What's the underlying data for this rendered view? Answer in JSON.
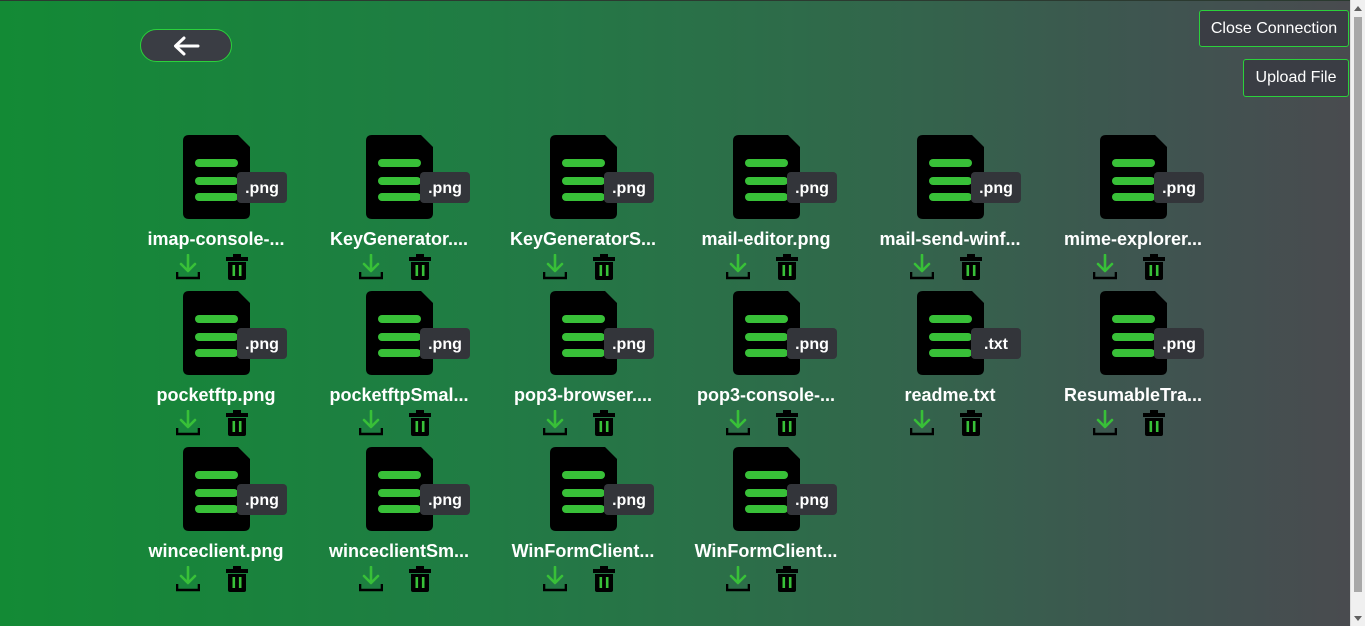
{
  "header": {
    "back_icon": "arrow-left-icon",
    "close_connection_label": "Close Connection",
    "upload_file_label": "Upload File"
  },
  "colors": {
    "accent": "#2bd13b",
    "button_bg": "#3a3d44",
    "icon_body": "#000000",
    "icon_lines": "#38c038",
    "badge_bg": "#33353a"
  },
  "files": [
    {
      "name": "imap-console-...",
      "ext": ".png"
    },
    {
      "name": "KeyGenerator....",
      "ext": ".png"
    },
    {
      "name": "KeyGeneratorS...",
      "ext": ".png"
    },
    {
      "name": "mail-editor.png",
      "ext": ".png"
    },
    {
      "name": "mail-send-winf...",
      "ext": ".png"
    },
    {
      "name": "mime-explorer...",
      "ext": ".png"
    },
    {
      "name": "pocketftp.png",
      "ext": ".png"
    },
    {
      "name": "pocketftpSmal...",
      "ext": ".png"
    },
    {
      "name": "pop3-browser....",
      "ext": ".png"
    },
    {
      "name": "pop3-console-...",
      "ext": ".png"
    },
    {
      "name": "readme.txt",
      "ext": ".txt"
    },
    {
      "name": "ResumableTra...",
      "ext": ".png"
    },
    {
      "name": "winceclient.png",
      "ext": ".png"
    },
    {
      "name": "winceclientSm...",
      "ext": ".png"
    },
    {
      "name": "WinFormClient...",
      "ext": ".png"
    },
    {
      "name": "WinFormClient...",
      "ext": ".png"
    }
  ],
  "file_actions": {
    "download_icon": "download-icon",
    "delete_icon": "trash-icon"
  }
}
